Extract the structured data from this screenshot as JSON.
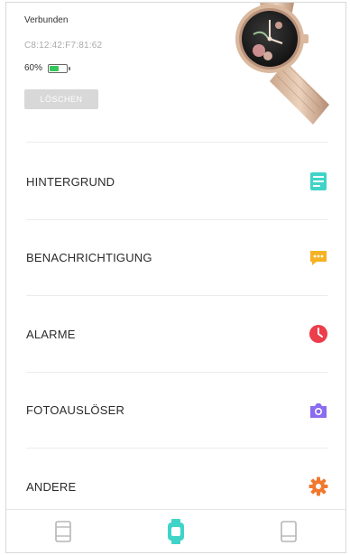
{
  "device": {
    "status": "Verbunden",
    "mac": "C8:12:42:F7:81:62",
    "battery_text": "60%",
    "battery_level": 0.6,
    "unbind_label": "LÖSCHEN"
  },
  "menu": {
    "items": [
      {
        "label": "HINTERGRUND",
        "icon": "wallpaper-icon",
        "color": "#3fd4c7"
      },
      {
        "label": "BENACHRICHTIGUNG",
        "icon": "message-icon",
        "color": "#f5b324"
      },
      {
        "label": "ALARME",
        "icon": "clock-icon",
        "color": "#ec3d4a"
      },
      {
        "label": "FOTOAUSLÖSER",
        "icon": "camera-icon",
        "color": "#8a6cf0"
      },
      {
        "label": "ANDERE",
        "icon": "gear-icon",
        "color": "#f2782e"
      }
    ]
  },
  "tabbar": {
    "tabs": [
      {
        "name": "tab-dial",
        "icon": "dial-icon",
        "active": false
      },
      {
        "name": "tab-device",
        "icon": "watch-icon",
        "active": true
      },
      {
        "name": "tab-profile",
        "icon": "profile-icon",
        "active": false
      }
    ],
    "active_color": "#3fd4c7",
    "inactive_color": "#b5b5b5"
  }
}
